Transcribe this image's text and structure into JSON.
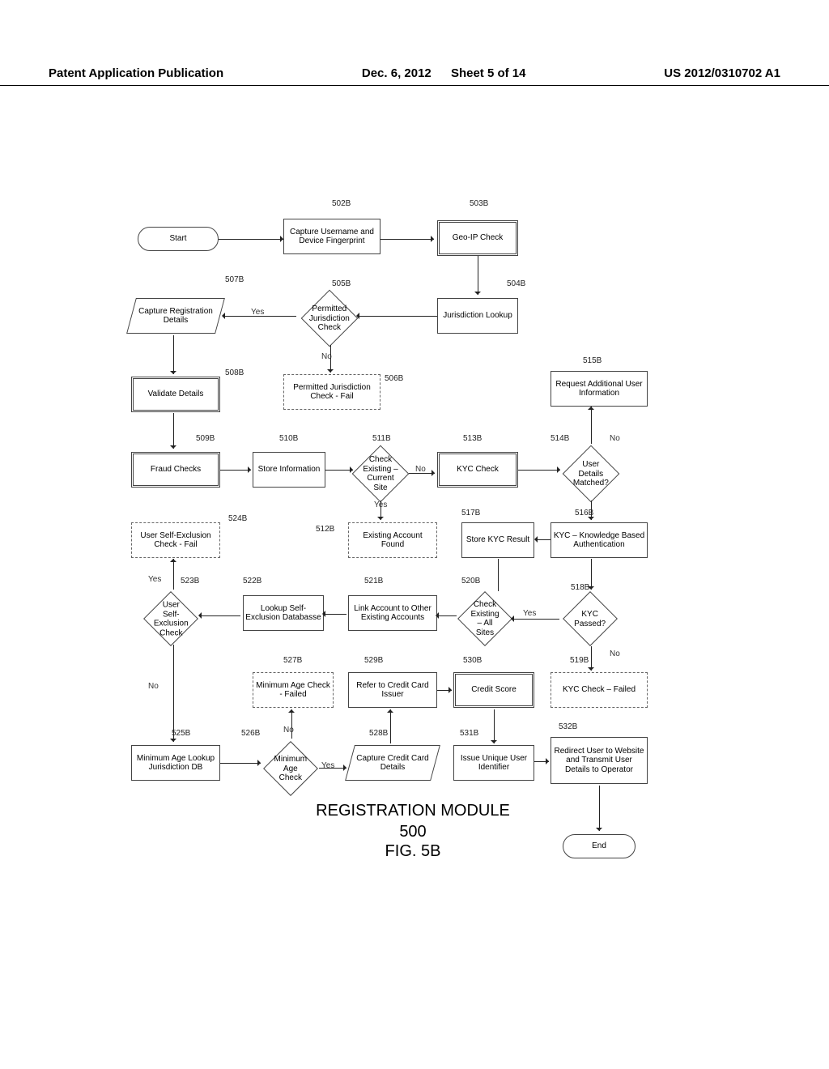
{
  "header": {
    "left": "Patent Application Publication",
    "date": "Dec. 6, 2012",
    "sheet": "Sheet 5 of 14",
    "right": "US 2012/0310702 A1"
  },
  "title": {
    "main": "REGISTRATION MODULE",
    "number": "500",
    "fig": "FIG. 5B"
  },
  "refs": {
    "r502": "502B",
    "r503": "503B",
    "r504": "504B",
    "r505": "505B",
    "r506": "506B",
    "r507": "507B",
    "r508": "508B",
    "r509": "509B",
    "r510": "510B",
    "r511": "511B",
    "r512": "512B",
    "r513": "513B",
    "r514": "514B",
    "r515": "515B",
    "r516": "516B",
    "r517": "517B",
    "r518": "518B",
    "r519": "519B",
    "r520": "520B",
    "r521": "521B",
    "r522": "522B",
    "r523": "523B",
    "r524": "524B",
    "r525": "525B",
    "r526": "526B",
    "r527": "527B",
    "r528": "528B",
    "r529": "529B",
    "r530": "530B",
    "r531": "531B",
    "r532": "532B"
  },
  "nodes": {
    "start": "Start",
    "n502": "Capture Username and Device Fingerprint",
    "n503": "Geo-IP Check",
    "n504": "Jurisdiction Lookup",
    "n505": "Permitted Jurisdiction Check",
    "n506": "Permitted Jurisdiction Check - Fail",
    "n507": "Capture Registration Details",
    "n508": "Validate Details",
    "n509": "Fraud Checks",
    "n510": "Store Information",
    "n511": "Check Existing – Current Site",
    "n512": "Existing Account Found",
    "n513": "KYC Check",
    "n514": "User Details Matched?",
    "n515": "Request Additional User Information",
    "n516": "KYC – Knowledge Based Authentication",
    "n517": "Store KYC Result",
    "n518": "KYC Passed?",
    "n519": "KYC Check – Failed",
    "n520": "Check Existing – All Sites",
    "n521": "Link Account to Other Existing Accounts",
    "n522": "Lookup Self-Exclusion Databasse",
    "n523": "User Self-Exclusion Check",
    "n524": "User Self-Exclusion Check - Fail",
    "n525": "Minimum Age Lookup Jurisdiction DB",
    "n526": "Minimum Age Check",
    "n527": "Minimum Age Check - Failed",
    "n528": "Capture Credit Card Details",
    "n529": "Refer to Credit Card Issuer",
    "n530": "Credit Score",
    "n531": "Issue Unique User Identifier",
    "n532": "Redirect User to Website and Transmit User Details to Operator",
    "end": "End"
  },
  "labels": {
    "yes": "Yes",
    "no": "No"
  }
}
